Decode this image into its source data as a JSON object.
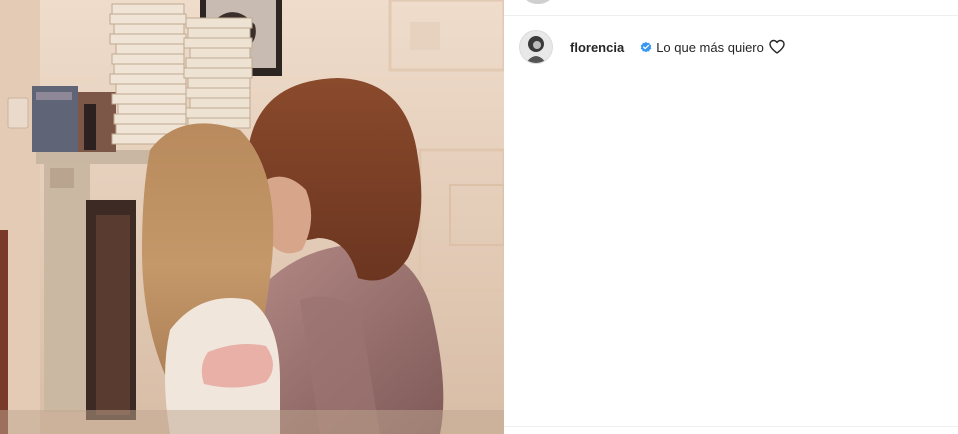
{
  "post": {
    "username": "florencia",
    "verified": true,
    "caption": "Lo que más quiero"
  },
  "icons": {
    "verified": "verified-badge-icon",
    "like": "heart-outline-icon"
  },
  "colors": {
    "verified_blue": "#3897f0",
    "text": "#262626",
    "divider": "#efefef"
  }
}
